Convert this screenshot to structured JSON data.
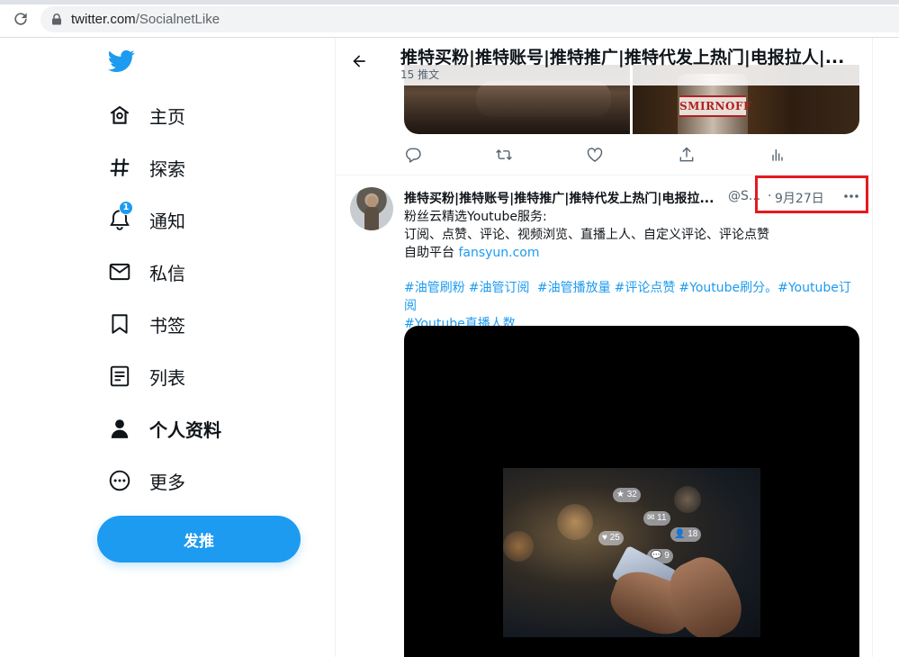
{
  "browser": {
    "url_host": "twitter.com",
    "url_path": "/SocialnetLike"
  },
  "sidebar": {
    "items": [
      {
        "id": "home",
        "label": "主页",
        "icon": "home-icon"
      },
      {
        "id": "explore",
        "label": "探索",
        "icon": "hashtag-icon"
      },
      {
        "id": "notifications",
        "label": "通知",
        "icon": "bell-icon",
        "badge": "1"
      },
      {
        "id": "messages",
        "label": "私信",
        "icon": "mail-icon"
      },
      {
        "id": "bookmarks",
        "label": "书签",
        "icon": "bookmark-icon"
      },
      {
        "id": "lists",
        "label": "列表",
        "icon": "list-icon"
      },
      {
        "id": "profile",
        "label": "个人资料",
        "icon": "person-icon",
        "active": true
      },
      {
        "id": "more",
        "label": "更多",
        "icon": "more-circle-icon"
      }
    ],
    "tweet_button": "发推"
  },
  "header": {
    "title": "推特买粉|推特账号|推特推广|推特代发上热门|电报拉人|...",
    "subtitle": "15 推文"
  },
  "prev_tweet": {
    "media_text": "SMIRNOFF"
  },
  "tweet": {
    "name": "推特买粉|推特账号|推特推广|推特代发上热门|电报拉...",
    "handle": "@S...",
    "dot": "·",
    "date": "9月27日",
    "body_lines": [
      "粉丝云精选Youtube服务:",
      "订阅、点赞、评论、视频浏览、直播上人、自定义评论、评论点赞"
    ],
    "line3_prefix": "自助平台 ",
    "link": "fansyun.com",
    "hashtags": [
      "#油管刷粉",
      "#油管订阅",
      "#油管播放量",
      "#评论点赞",
      "#Youtube刷分。#Youtube订阅",
      "#Youtube直播人数"
    ],
    "media_bubbles": {
      "star": "32",
      "mail": "11",
      "heart": "25",
      "user": "18",
      "comment": "9"
    }
  },
  "colors": {
    "accent": "#1d9bf0",
    "highlight": "#e6191f",
    "text": "#0f1419",
    "muted": "#536471"
  }
}
